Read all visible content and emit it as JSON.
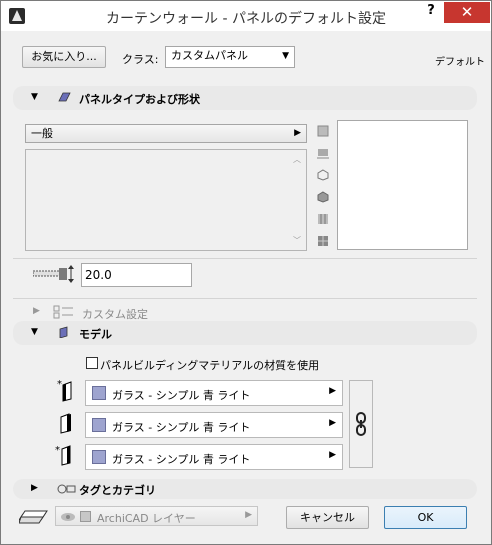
{
  "window": {
    "title": "カーテンウォール - パネルのデフォルト設定",
    "help_label": "?",
    "close_label": "✕"
  },
  "top": {
    "favorites_label": "お気に入り...",
    "class_label": "クラス:",
    "class_value": "カスタムパネル",
    "default_label": "デフォルト"
  },
  "panel_type": {
    "title": "パネルタイプおよび形状",
    "category_value": "一般",
    "thickness_value": "20.0"
  },
  "custom": {
    "title": "カスタム設定"
  },
  "model": {
    "title": "モデル",
    "checkbox_label": "パネルビルディングマテリアルの材質を使用",
    "materials": [
      {
        "name": "ガラス - シンプル 青 ライト"
      },
      {
        "name": "ガラス - シンプル 青 ライト"
      },
      {
        "name": "ガラス - シンプル 青 ライト"
      }
    ]
  },
  "tags": {
    "title": "タグとカテゴリ"
  },
  "footer": {
    "layer_value": "ArchiCAD レイヤー",
    "cancel_label": "キャンセル",
    "ok_label": "OK"
  },
  "colors": {
    "close_button": "#c7362f",
    "material_swatch": "#9ea4cf",
    "ok_border": "#3c7fb1"
  }
}
